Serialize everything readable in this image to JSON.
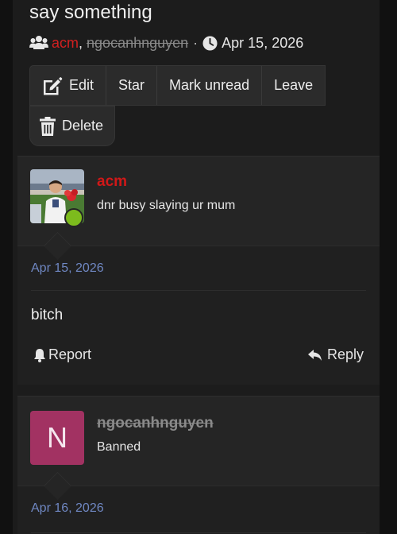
{
  "topic": {
    "title": "say something",
    "authors": [
      {
        "name": "acm"
      },
      {
        "name": "ngocanhnguyen"
      }
    ],
    "author_separator": ",",
    "meta_dot": "·",
    "date": "Apr 15, 2026"
  },
  "actions": {
    "edit": "Edit",
    "star": "Star",
    "mark_unread": "Mark unread",
    "leave": "Leave",
    "delete": "Delete"
  },
  "posts": [
    {
      "username": "acm",
      "user_title": "dnr busy slaying ur mum",
      "date": "Apr 15, 2026",
      "body": "bitch",
      "report_label": "Report",
      "reply_label": "Reply",
      "online": true
    },
    {
      "username": "ngocanhnguyen",
      "avatar_letter": "N",
      "user_title": "Banned",
      "date": "Apr 16, 2026"
    }
  ],
  "colors": {
    "background": "#1c1c1c",
    "username_red": "#d01818",
    "banned_gray": "#8a8a8a",
    "date_blue": "#6f87c2",
    "avatar_letter_bg": "#a23262",
    "online_green": "#7dbb1d"
  },
  "icons": {
    "users": "users-icon",
    "clock": "clock-icon",
    "edit": "edit-icon",
    "delete": "trash-icon",
    "report": "bell-icon",
    "reply": "reply-icon"
  }
}
